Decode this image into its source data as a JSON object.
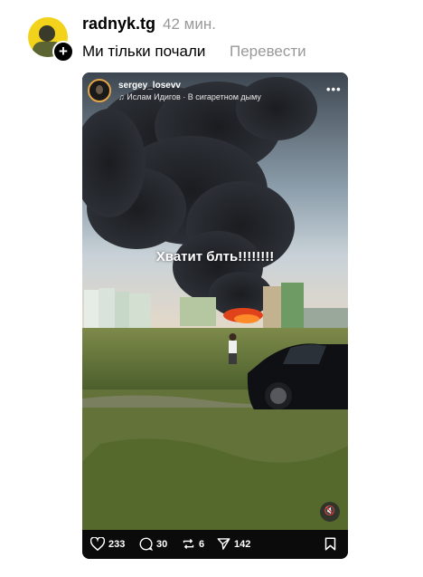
{
  "post": {
    "username": "radnyk.tg",
    "time": "42 мин.",
    "caption": "Ми тільки почали",
    "translate_label": "Перевести"
  },
  "embedded": {
    "username": "sergey_losevv",
    "music": "Ислам Идигов · В сигаретном дыму",
    "overlay_text": "Хватит блть!!!!!!!!",
    "likes": "233",
    "comments": "30",
    "reposts": "6",
    "shares": "142"
  },
  "icons": {
    "author": "avatar",
    "follow": "plus-icon",
    "music": "music-note-icon",
    "more": "more-dots-icon",
    "mute": "speaker-muted-icon",
    "like": "heart-icon",
    "comment": "comment-bubble-icon",
    "repost": "repost-icon",
    "share": "send-icon",
    "save": "bookmark-icon"
  }
}
